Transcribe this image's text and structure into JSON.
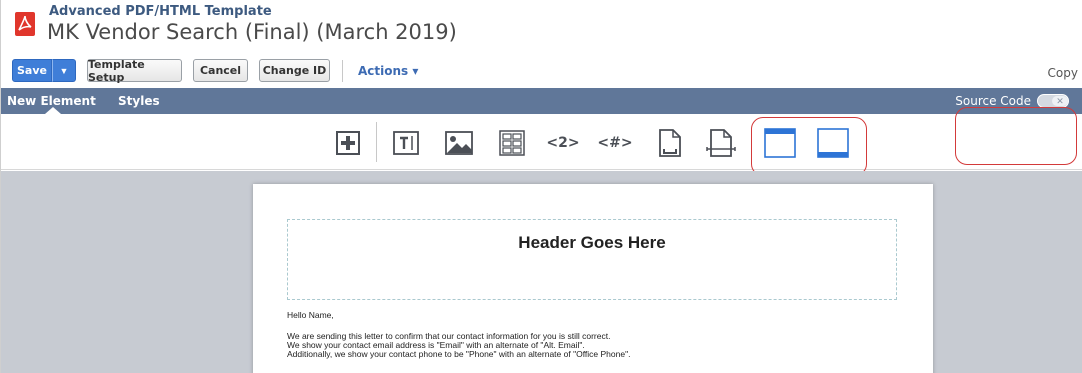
{
  "header": {
    "record_type": "Advanced PDF/HTML Template",
    "record_title": "MK Vendor Search (Final) (March 2019)"
  },
  "toolbar": {
    "save_label": "Save",
    "save_dropdown": "▼",
    "template_setup_label": "Template Setup",
    "cancel_label": "Cancel",
    "change_id_label": "Change ID",
    "actions_label": "Actions ▾",
    "copy_label": "Copy"
  },
  "tabs": {
    "new_element": "New Element",
    "styles": "Styles",
    "source_code_label": "Source Code",
    "source_code_toggle": "✕"
  },
  "element_icons": [
    "add-element-icon",
    "text-icon",
    "image-icon",
    "table-icon",
    "field-icon",
    "page-number-icon",
    "page-break-icon",
    "footer-break-icon",
    "header-layout-icon",
    "footer-layout-icon"
  ],
  "element_icon_text": {
    "field": "<2>",
    "page_number": "<#>"
  },
  "colors": {
    "accent_blue": "#3f7ed8",
    "tab_bar": "#607799",
    "annotation_red": "#d33a3a",
    "canvas_gray": "#c7cbd2"
  },
  "document": {
    "header_text": "Header Goes Here",
    "greeting": "Hello Name,",
    "lines": [
      "We are sending this letter to confirm that our contact information for you is still correct.",
      "We show your contact email address is \"Email\" with an alternate of \"Alt. Email\".",
      "Additionally, we show your contact phone to be \"Phone\" with an alternate of \"Office Phone\"."
    ]
  }
}
